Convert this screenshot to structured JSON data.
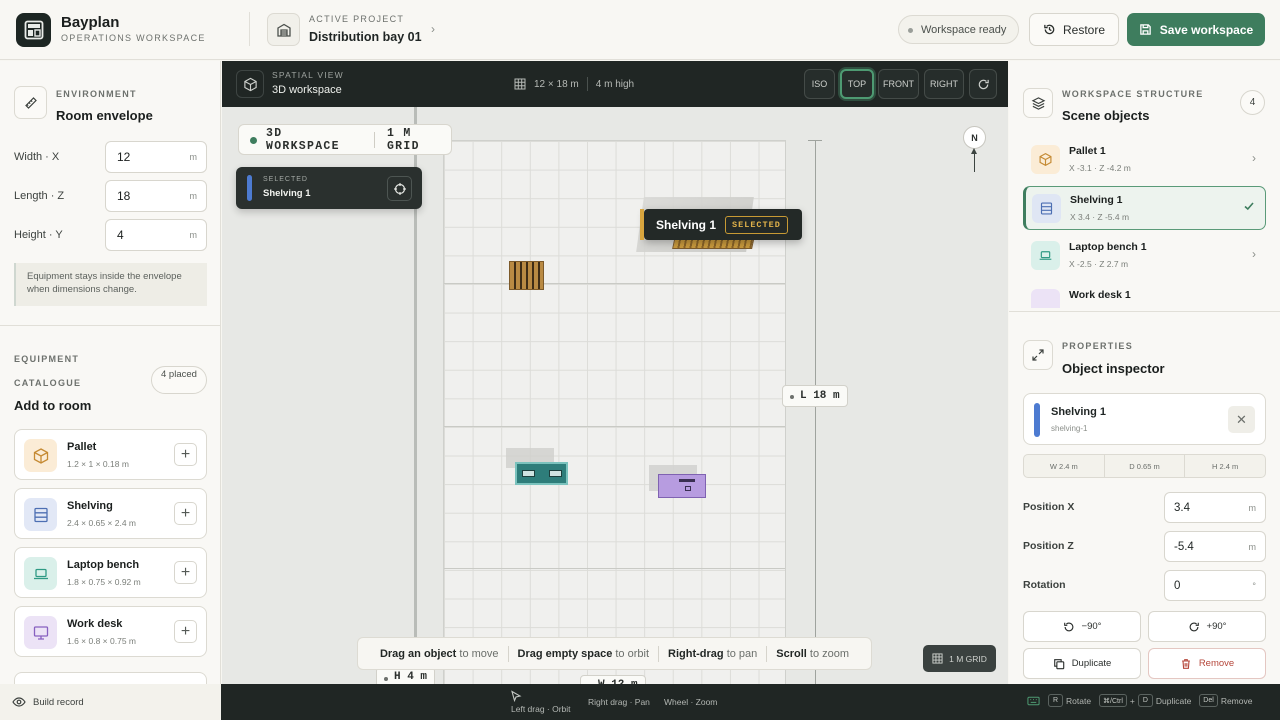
{
  "header": {
    "brand": "Bayplan",
    "brand_sub": "OPERATIONS WORKSPACE",
    "project_label": "ACTIVE PROJECT",
    "project_name": "Distribution bay 01",
    "status": "Workspace ready",
    "restore": "Restore",
    "save": "Save workspace"
  },
  "environment": {
    "label": "ENVIRONMENT",
    "title": "Room envelope",
    "fields": [
      {
        "label": "Width · X",
        "value": "12",
        "unit": "m"
      },
      {
        "label": "Length · Z",
        "value": "18",
        "unit": "m"
      },
      {
        "label": "Height · Y",
        "value": "4",
        "unit": "m"
      }
    ],
    "note": "Equipment stays inside the envelope when dimensions change."
  },
  "catalogue": {
    "label1": "EQUIPMENT",
    "label2": "CATALOGUE",
    "title": "Add to room",
    "placed": "4 placed",
    "items": [
      {
        "name": "Pallet",
        "dims": "1.2 × 1 × 0.18 m",
        "icon": "box-icon"
      },
      {
        "name": "Shelving",
        "dims": "2.4 × 0.65 × 2.4 m",
        "icon": "shelving-icon"
      },
      {
        "name": "Laptop bench",
        "dims": "1.8 × 0.75 × 0.92 m",
        "icon": "laptop-icon"
      },
      {
        "name": "Work desk",
        "dims": "1.6 × 0.8 × 0.75 m",
        "icon": "monitor-icon"
      }
    ]
  },
  "viewport": {
    "label": "SPATIAL VIEW",
    "title": "3D workspace",
    "dims": "12 × 18 m",
    "height": "4 m high",
    "views": [
      "ISO",
      "TOP",
      "FRONT",
      "RIGHT"
    ],
    "active_view": "TOP",
    "badge_a": "3D WORKSPACE",
    "badge_b": "1 M GRID",
    "selected_label": "SELECTED",
    "selected_name": "Shelving 1",
    "compass": "N",
    "tip_name": "Shelving 1",
    "tip_tag": "SELECTED",
    "dim_length": "L 18 m",
    "dim_height": "H 4 m",
    "dim_width": "W 12 m",
    "grid_badge": "1 M GRID",
    "help": [
      {
        "key": "Drag an object",
        "text": "to move"
      },
      {
        "key": "Drag empty space",
        "text": "to orbit"
      },
      {
        "key": "Right-drag",
        "text": "to pan"
      },
      {
        "key": "Scroll",
        "text": "to zoom"
      }
    ]
  },
  "structure": {
    "label": "WORKSPACE STRUCTURE",
    "title": "Scene objects",
    "count": "4",
    "objects": [
      {
        "name": "Pallet 1",
        "pos": "X -3.1 · Z -4.2 m"
      },
      {
        "name": "Shelving 1",
        "pos": "X 3.4 · Z -5.4 m"
      },
      {
        "name": "Laptop bench 1",
        "pos": "X -2.5 · Z 2.7 m"
      },
      {
        "name": "Work desk 1",
        "pos": ""
      }
    ]
  },
  "inspector": {
    "label": "PROPERTIES",
    "title": "Object inspector",
    "name": "Shelving 1",
    "id": "shelving-1",
    "dims": [
      "W 2.4 m",
      "D 0.65 m",
      "H 2.4 m"
    ],
    "fields": [
      {
        "label": "Position X",
        "value": "3.4",
        "unit": "m"
      },
      {
        "label": "Position Z",
        "value": "-5.4",
        "unit": "m"
      },
      {
        "label": "Rotation",
        "value": "0",
        "unit": "°"
      }
    ],
    "rot_left": "−90°",
    "rot_right": "+90°",
    "duplicate": "Duplicate",
    "remove": "Remove"
  },
  "footer": {
    "build": "Build record",
    "hints": [
      "Left drag · Orbit",
      "Right drag · Pan",
      "Wheel · Zoom"
    ],
    "rotate": "Rotate",
    "duplicate": "Duplicate",
    "remove": "Remove",
    "key_r": "R",
    "key_ctrl": "⌘/Ctrl",
    "key_d": "D",
    "key_del": "Del"
  },
  "colors": {
    "accent": "#3e7d5e",
    "dark": "#202624",
    "selected": "#4d7bd1"
  }
}
